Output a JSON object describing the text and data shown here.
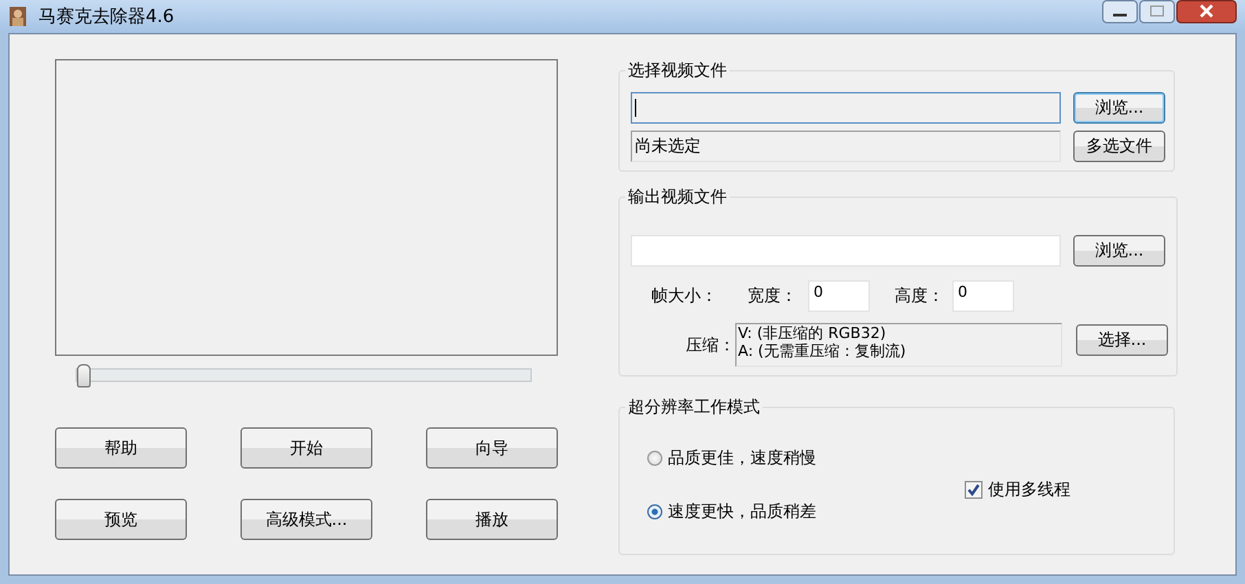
{
  "window": {
    "title": "马赛克去除器4.6"
  },
  "preview": {
    "slider": {
      "level": 0
    }
  },
  "buttons": [
    "帮助",
    "开始",
    "向导",
    "预览",
    "高级模式...",
    "播放"
  ],
  "input_group": {
    "title": "选择视频文件",
    "browse_button": "浏览...",
    "status": "尚未选定",
    "multi_button": "多选文件"
  },
  "output_group": {
    "title": "输出视频文件",
    "browse_button": "浏览...",
    "frame_size_label": "帧大小：",
    "width_label": "宽度：",
    "width_value": "0",
    "height_label": "高度：",
    "height_value": "0",
    "compression_label": "压缩：",
    "compression_lines": [
      "V: (非压缩的 RGB32)",
      "A: (无需重压缩：复制流)"
    ],
    "select_button": "选择..."
  },
  "mode_group": {
    "title": "超分辨率工作模式",
    "options": [
      {
        "label": "品质更佳，速度稍慢",
        "selected": false
      },
      {
        "label": "速度更快，品质稍差",
        "selected": true
      }
    ],
    "multithread": {
      "label": "使用多线程",
      "checked": true
    }
  }
}
